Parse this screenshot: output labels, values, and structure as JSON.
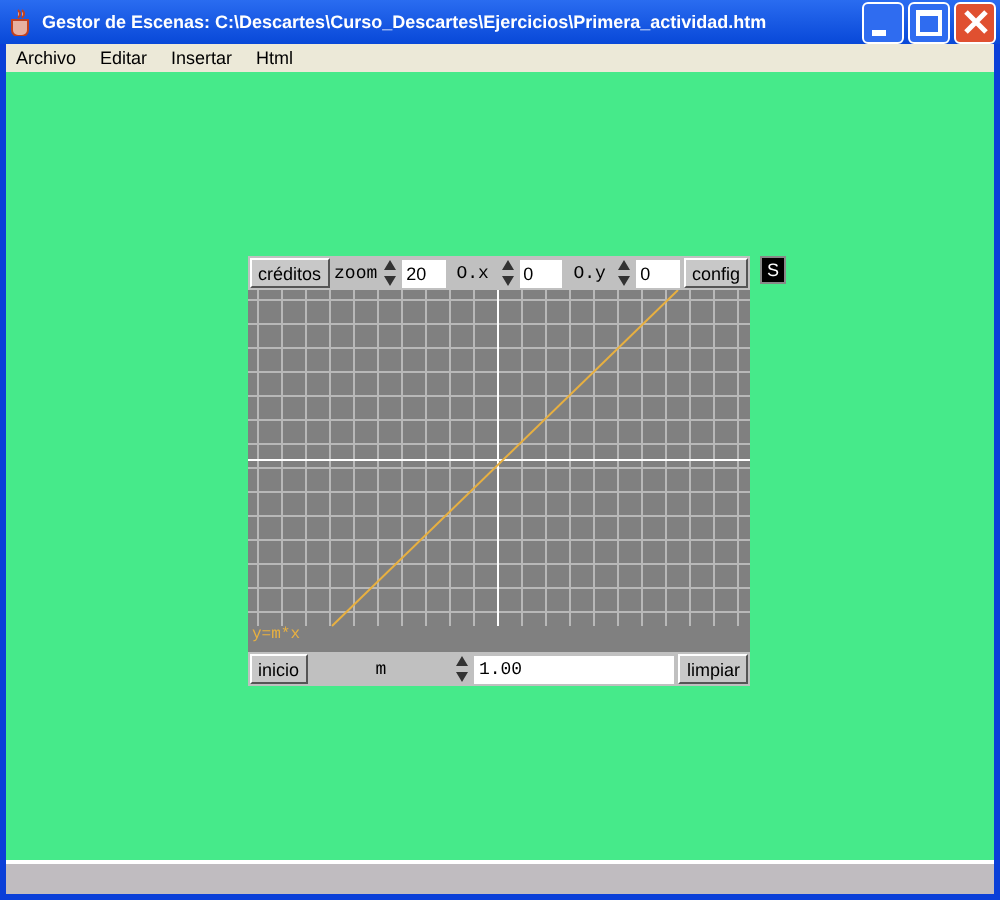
{
  "window": {
    "title": "Gestor de Escenas: C:\\Descartes\\Curso_Descartes\\Ejercicios\\Primera_actividad.htm"
  },
  "menu": [
    "Archivo",
    "Editar",
    "Insertar",
    "Html"
  ],
  "applet": {
    "top_controls": [
      {
        "kind": "button",
        "label": "créditos"
      },
      {
        "kind": "spinner",
        "label": "zoom",
        "value": "20"
      },
      {
        "kind": "spinner",
        "label": "O.x",
        "value": "0"
      },
      {
        "kind": "spinner",
        "label": "O.y",
        "value": "0"
      },
      {
        "kind": "button",
        "label": "config"
      }
    ],
    "side_button": "S",
    "function_label": "y=m*x",
    "bottom_controls": [
      {
        "kind": "button",
        "label": "inicio"
      },
      {
        "kind": "spinner",
        "label": "m",
        "value": "1.00"
      },
      {
        "kind": "button",
        "label": "limpiar"
      }
    ]
  }
}
